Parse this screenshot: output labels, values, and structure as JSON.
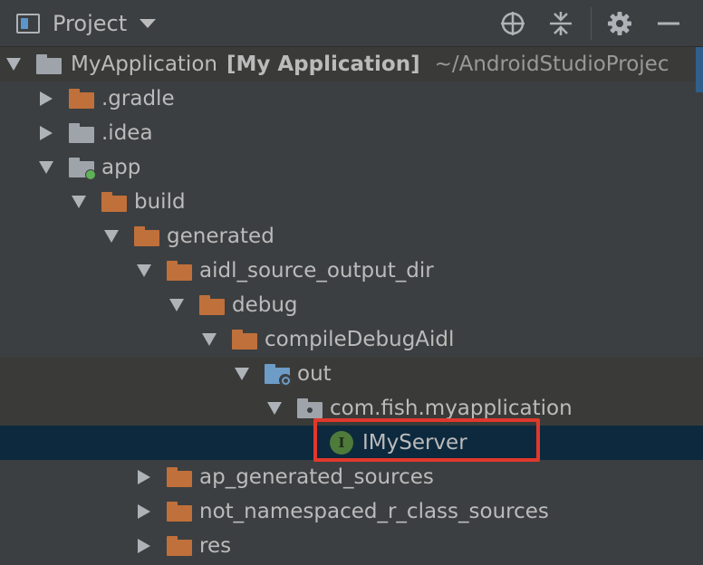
{
  "header": {
    "title": "Project",
    "icons": [
      "project-view-icon",
      "locate-icon",
      "collapse-all-icon",
      "gear-icon",
      "hide-icon"
    ]
  },
  "tree": {
    "root": {
      "name": "MyApplication",
      "module": "[My Application]",
      "path": "~/AndroidStudioProjec"
    },
    "items": [
      {
        "label": ".gradle"
      },
      {
        "label": ".idea"
      },
      {
        "label": "app"
      },
      {
        "label": "build"
      },
      {
        "label": "generated"
      },
      {
        "label": "aidl_source_output_dir"
      },
      {
        "label": "debug"
      },
      {
        "label": "compileDebugAidl"
      },
      {
        "label": "out"
      },
      {
        "label": "com.fish.myapplication"
      },
      {
        "label": "IMyServer",
        "icon_letter": "I"
      },
      {
        "label": "ap_generated_sources"
      },
      {
        "label": "not_namespaced_r_class_sources"
      },
      {
        "label": "res"
      }
    ]
  },
  "colors": {
    "background": "#3c3f41",
    "selected_row": "#0d293e",
    "folder_orange": "#c0703a",
    "folder_grey": "#9ea4aa",
    "interface_icon": "#4e7a3a",
    "highlight_box": "#e0382c"
  }
}
